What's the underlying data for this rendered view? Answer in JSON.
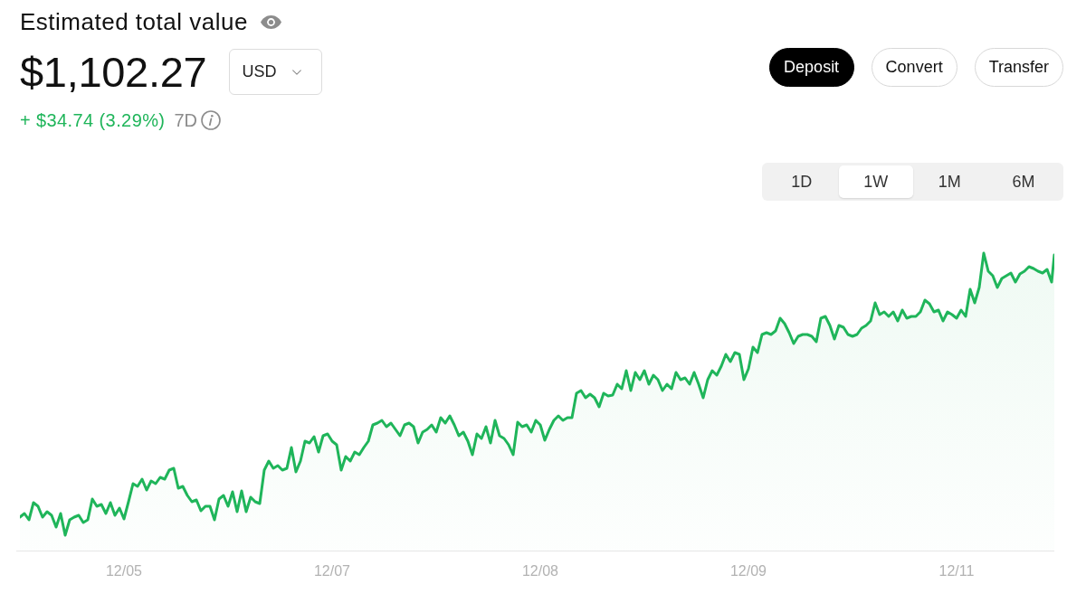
{
  "header": {
    "title": "Estimated total value",
    "amount": "$1,102.27",
    "currency": {
      "value": "USD"
    },
    "change": {
      "text": "+ $34.74 (3.29%)",
      "positive": true
    },
    "period": "7D"
  },
  "actions": [
    {
      "label": "Deposit",
      "primary": true
    },
    {
      "label": "Convert",
      "primary": false
    },
    {
      "label": "Transfer",
      "primary": false
    }
  ],
  "range_tabs": [
    {
      "label": "1D",
      "selected": false
    },
    {
      "label": "1W",
      "selected": true
    },
    {
      "label": "1M",
      "selected": false
    },
    {
      "label": "6M",
      "selected": false
    }
  ],
  "chart": {
    "x_labels": [
      "12/05",
      "12/07",
      "12/08",
      "12/09",
      "12/11"
    ]
  }
}
